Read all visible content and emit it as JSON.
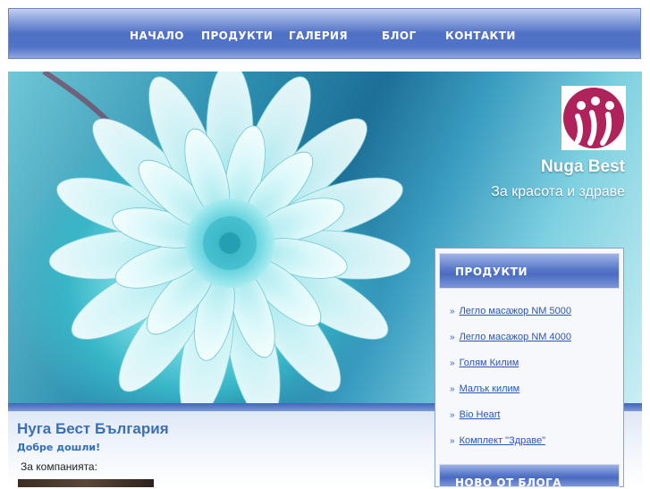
{
  "nav": {
    "items": [
      {
        "label": "НАЧАЛО"
      },
      {
        "label": "ПРОДУКТИ"
      },
      {
        "label": "ГАЛЕРИЯ"
      },
      {
        "label": "БЛОГ"
      },
      {
        "label": "КОНТАКТИ"
      }
    ]
  },
  "hero": {
    "brand": "Nuga Best",
    "tagline": "За красота и здраве",
    "logo_icon": "nuga-best-logo-icon"
  },
  "sidebar": {
    "products_title": "ПРОДУКТИ",
    "products": [
      {
        "label": "Легло масажор NM 5000"
      },
      {
        "label": "Легло масажор NM 4000"
      },
      {
        "label": "Голям Килим"
      },
      {
        "label": "Малък килим"
      },
      {
        "label": "Bio Heart"
      },
      {
        "label": "Комплект \"Здраве\""
      }
    ],
    "blog_title": "НОВО ОТ БЛОГА"
  },
  "content": {
    "title": "Нуга Бест България",
    "welcome": "Добре дошли!",
    "about_label": "За компанията:"
  },
  "colors": {
    "nav_blue": "#4f70c4",
    "link_blue": "#2a55b5",
    "title_blue": "#3b6fb6",
    "logo_magenta": "#b0225c"
  }
}
